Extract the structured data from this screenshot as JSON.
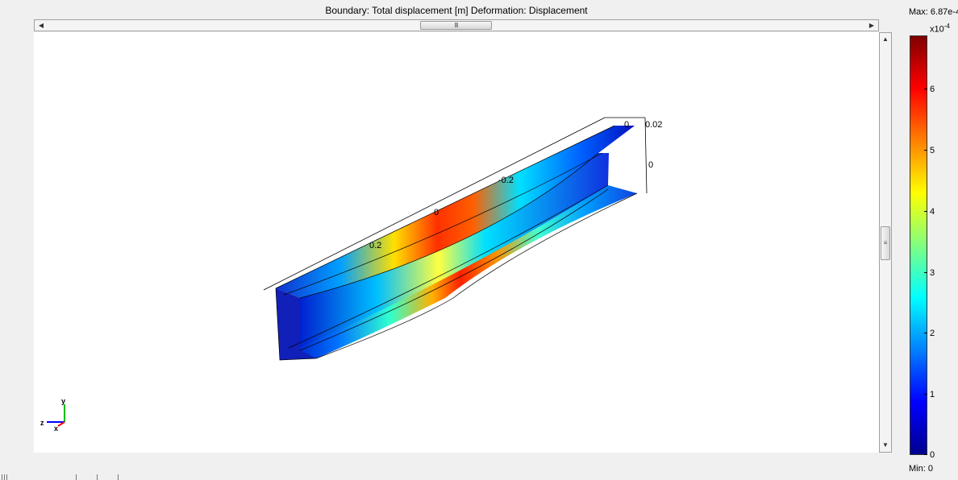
{
  "plot": {
    "title": "Boundary: Total displacement [m]   Deformation: Displacement"
  },
  "axis_labels": {
    "x_ticks": [
      "0.2",
      "0",
      "-0.2",
      "0"
    ],
    "z_ticks": [
      "0.02",
      "0"
    ]
  },
  "triad": {
    "y": "y",
    "z": "z",
    "x": "x"
  },
  "colorbar": {
    "max_label": "Max: 6.87e-4",
    "min_label": "Min: 0",
    "exponent_base": "x10",
    "exponent_power": "-4",
    "ticks": [
      "6",
      "5",
      "4",
      "3",
      "2",
      "1",
      "0"
    ],
    "colormap": "jet",
    "range": [
      0,
      6.87
    ]
  },
  "scrollbars": {
    "horizontal_grip": "III",
    "vertical_grip": "III"
  },
  "icons": {
    "scroll_left": "triangle-left",
    "scroll_right": "triangle-right",
    "scroll_up": "triangle-up",
    "scroll_down": "triangle-down"
  }
}
